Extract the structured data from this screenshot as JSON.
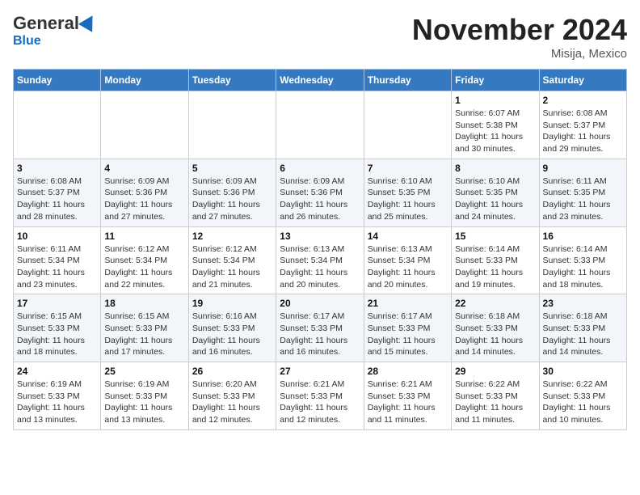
{
  "header": {
    "logo_general": "General",
    "logo_blue": "Blue",
    "month_title": "November 2024",
    "location": "Misija, Mexico"
  },
  "weekdays": [
    "Sunday",
    "Monday",
    "Tuesday",
    "Wednesday",
    "Thursday",
    "Friday",
    "Saturday"
  ],
  "weeks": [
    [
      {
        "day": "",
        "info": ""
      },
      {
        "day": "",
        "info": ""
      },
      {
        "day": "",
        "info": ""
      },
      {
        "day": "",
        "info": ""
      },
      {
        "day": "",
        "info": ""
      },
      {
        "day": "1",
        "info": "Sunrise: 6:07 AM\nSunset: 5:38 PM\nDaylight: 11 hours and 30 minutes."
      },
      {
        "day": "2",
        "info": "Sunrise: 6:08 AM\nSunset: 5:37 PM\nDaylight: 11 hours and 29 minutes."
      }
    ],
    [
      {
        "day": "3",
        "info": "Sunrise: 6:08 AM\nSunset: 5:37 PM\nDaylight: 11 hours and 28 minutes."
      },
      {
        "day": "4",
        "info": "Sunrise: 6:09 AM\nSunset: 5:36 PM\nDaylight: 11 hours and 27 minutes."
      },
      {
        "day": "5",
        "info": "Sunrise: 6:09 AM\nSunset: 5:36 PM\nDaylight: 11 hours and 27 minutes."
      },
      {
        "day": "6",
        "info": "Sunrise: 6:09 AM\nSunset: 5:36 PM\nDaylight: 11 hours and 26 minutes."
      },
      {
        "day": "7",
        "info": "Sunrise: 6:10 AM\nSunset: 5:35 PM\nDaylight: 11 hours and 25 minutes."
      },
      {
        "day": "8",
        "info": "Sunrise: 6:10 AM\nSunset: 5:35 PM\nDaylight: 11 hours and 24 minutes."
      },
      {
        "day": "9",
        "info": "Sunrise: 6:11 AM\nSunset: 5:35 PM\nDaylight: 11 hours and 23 minutes."
      }
    ],
    [
      {
        "day": "10",
        "info": "Sunrise: 6:11 AM\nSunset: 5:34 PM\nDaylight: 11 hours and 23 minutes."
      },
      {
        "day": "11",
        "info": "Sunrise: 6:12 AM\nSunset: 5:34 PM\nDaylight: 11 hours and 22 minutes."
      },
      {
        "day": "12",
        "info": "Sunrise: 6:12 AM\nSunset: 5:34 PM\nDaylight: 11 hours and 21 minutes."
      },
      {
        "day": "13",
        "info": "Sunrise: 6:13 AM\nSunset: 5:34 PM\nDaylight: 11 hours and 20 minutes."
      },
      {
        "day": "14",
        "info": "Sunrise: 6:13 AM\nSunset: 5:34 PM\nDaylight: 11 hours and 20 minutes."
      },
      {
        "day": "15",
        "info": "Sunrise: 6:14 AM\nSunset: 5:33 PM\nDaylight: 11 hours and 19 minutes."
      },
      {
        "day": "16",
        "info": "Sunrise: 6:14 AM\nSunset: 5:33 PM\nDaylight: 11 hours and 18 minutes."
      }
    ],
    [
      {
        "day": "17",
        "info": "Sunrise: 6:15 AM\nSunset: 5:33 PM\nDaylight: 11 hours and 18 minutes."
      },
      {
        "day": "18",
        "info": "Sunrise: 6:15 AM\nSunset: 5:33 PM\nDaylight: 11 hours and 17 minutes."
      },
      {
        "day": "19",
        "info": "Sunrise: 6:16 AM\nSunset: 5:33 PM\nDaylight: 11 hours and 16 minutes."
      },
      {
        "day": "20",
        "info": "Sunrise: 6:17 AM\nSunset: 5:33 PM\nDaylight: 11 hours and 16 minutes."
      },
      {
        "day": "21",
        "info": "Sunrise: 6:17 AM\nSunset: 5:33 PM\nDaylight: 11 hours and 15 minutes."
      },
      {
        "day": "22",
        "info": "Sunrise: 6:18 AM\nSunset: 5:33 PM\nDaylight: 11 hours and 14 minutes."
      },
      {
        "day": "23",
        "info": "Sunrise: 6:18 AM\nSunset: 5:33 PM\nDaylight: 11 hours and 14 minutes."
      }
    ],
    [
      {
        "day": "24",
        "info": "Sunrise: 6:19 AM\nSunset: 5:33 PM\nDaylight: 11 hours and 13 minutes."
      },
      {
        "day": "25",
        "info": "Sunrise: 6:19 AM\nSunset: 5:33 PM\nDaylight: 11 hours and 13 minutes."
      },
      {
        "day": "26",
        "info": "Sunrise: 6:20 AM\nSunset: 5:33 PM\nDaylight: 11 hours and 12 minutes."
      },
      {
        "day": "27",
        "info": "Sunrise: 6:21 AM\nSunset: 5:33 PM\nDaylight: 11 hours and 12 minutes."
      },
      {
        "day": "28",
        "info": "Sunrise: 6:21 AM\nSunset: 5:33 PM\nDaylight: 11 hours and 11 minutes."
      },
      {
        "day": "29",
        "info": "Sunrise: 6:22 AM\nSunset: 5:33 PM\nDaylight: 11 hours and 11 minutes."
      },
      {
        "day": "30",
        "info": "Sunrise: 6:22 AM\nSunset: 5:33 PM\nDaylight: 11 hours and 10 minutes."
      }
    ]
  ]
}
